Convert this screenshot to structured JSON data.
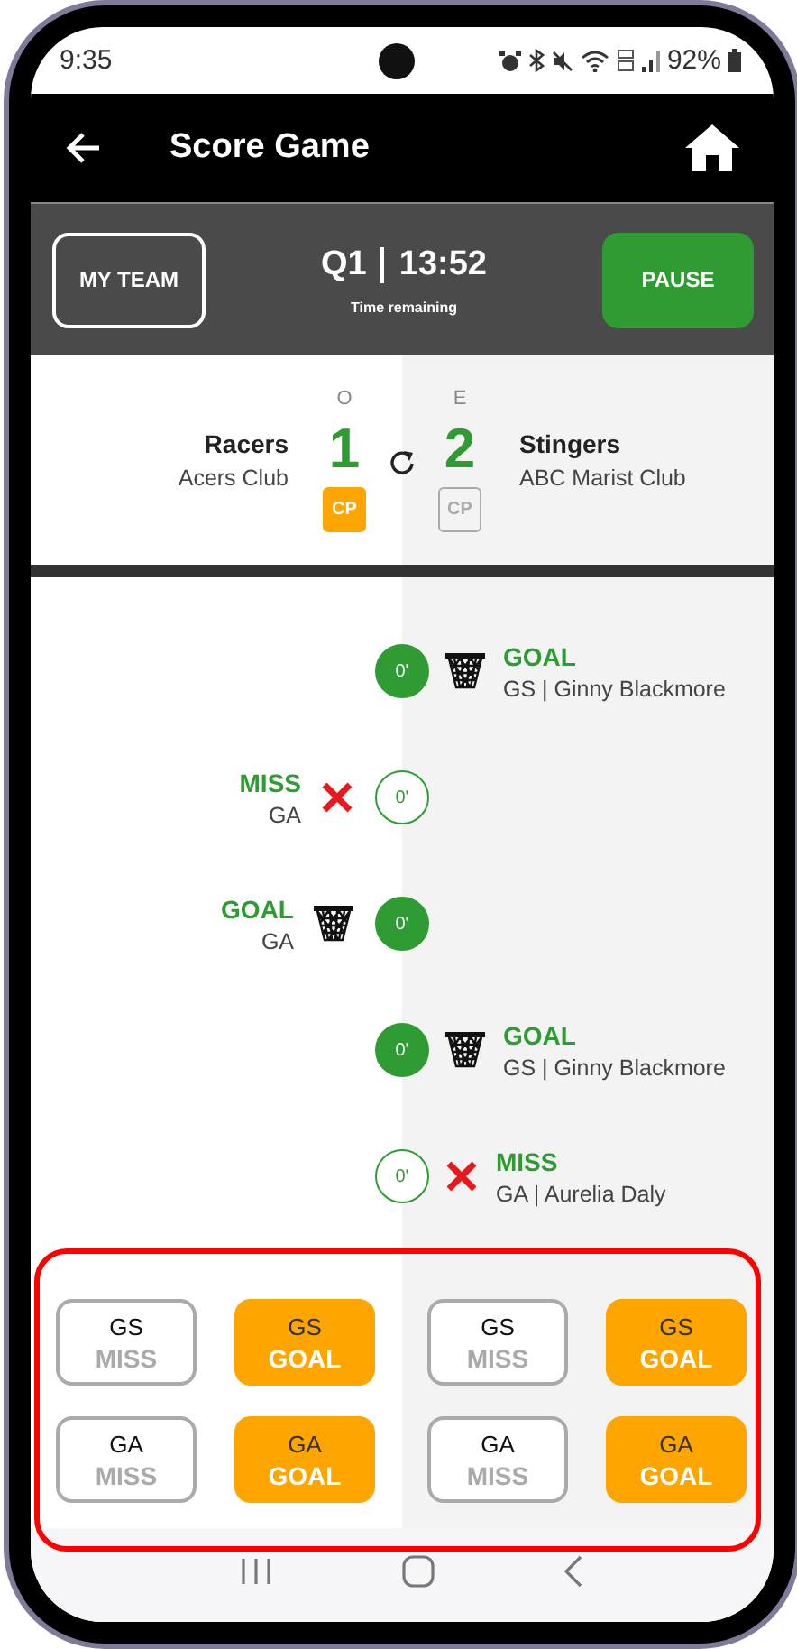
{
  "status_bar": {
    "time": "9:35",
    "battery": "92%"
  },
  "app_bar": {
    "title": "Score Game"
  },
  "control_panel": {
    "my_team_button": "MY TEAM",
    "quarter": "Q1",
    "clock": "13:52",
    "clock_caption": "Time remaining",
    "pause_button": "PAUSE"
  },
  "teams": [
    {
      "name": "Racers",
      "club": "Acers Club",
      "position": "O",
      "score": "1",
      "cp_label": "CP",
      "cp_selected": true
    },
    {
      "name": "Stingers",
      "club": "ABC Marist Club",
      "position": "E",
      "score": "2",
      "cp_label": "CP",
      "cp_selected": false
    }
  ],
  "events": [
    {
      "away_team": true,
      "kind": "goal",
      "time": "0'",
      "label": "GOAL",
      "detail": "GS | Ginny Blackmore"
    },
    {
      "away_team": false,
      "kind": "miss",
      "time": "0'",
      "label": "MISS",
      "detail": "GA"
    },
    {
      "away_team": false,
      "kind": "goal",
      "time": "0'",
      "label": "GOAL",
      "detail": "GA"
    },
    {
      "away_team": true,
      "kind": "goal",
      "time": "0'",
      "label": "GOAL",
      "detail": "GS | Ginny Blackmore"
    },
    {
      "away_team": true,
      "kind": "miss",
      "time": "0'",
      "label": "MISS",
      "detail": "GA | Aurelia Daly"
    }
  ],
  "score_buttons": [
    [
      {
        "kind": "miss",
        "position": "GS",
        "label": "MISS"
      },
      {
        "kind": "goal",
        "position": "GS",
        "label": "GOAL"
      },
      {
        "kind": "miss",
        "position": "GA",
        "label": "MISS"
      },
      {
        "kind": "goal",
        "position": "GA",
        "label": "GOAL"
      }
    ],
    [
      {
        "kind": "miss",
        "position": "GS",
        "label": "MISS"
      },
      {
        "kind": "goal",
        "position": "GS",
        "label": "GOAL"
      },
      {
        "kind": "miss",
        "position": "GA",
        "label": "MISS"
      },
      {
        "kind": "goal",
        "position": "GA",
        "label": "GOAL"
      }
    ]
  ]
}
